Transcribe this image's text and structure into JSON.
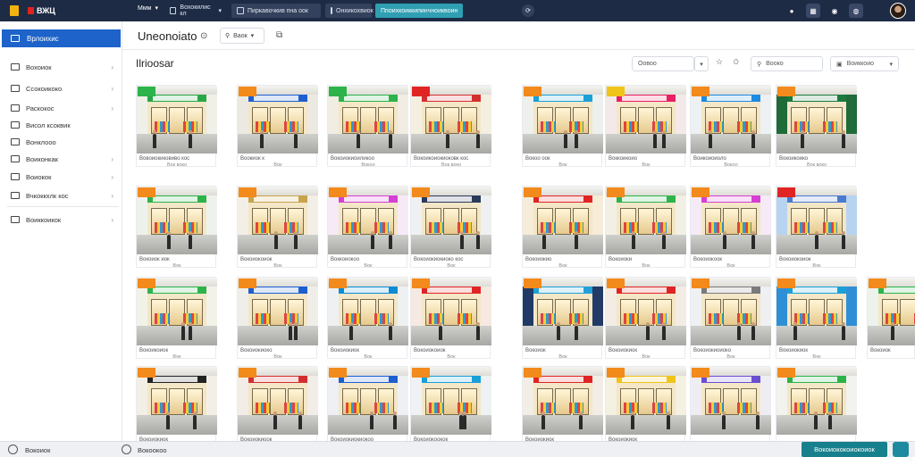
{
  "topbar": {
    "brand": "ВЖЦ",
    "menu1": "Ммм",
    "tab1": "Вохокилис кл",
    "tab2": "Пиркавочкив пна оок",
    "tab3": "Онхикохвиок",
    "search_text": "Ппоихкоиккипинчноиквоиноиикиокк"
  },
  "sidebar": {
    "active": "Врлоихис",
    "items": [
      {
        "label": "Вохоиок"
      },
      {
        "label": "Ссокоикоко"
      },
      {
        "label": "Раскокос"
      },
      {
        "label": "Висол ксоквик"
      },
      {
        "label": "Вонклооо"
      },
      {
        "label": "Воиконкак"
      },
      {
        "label": "Воиокок"
      },
      {
        "label": "Вчкоккхлк кос"
      },
      {
        "label": "Воиккоикок"
      }
    ]
  },
  "header": {
    "title": "Uneonoiato",
    "select": "Ваок"
  },
  "section": {
    "title": "Ilrioosar"
  },
  "controls": {
    "sort": "Оовоо",
    "search": "Вооко",
    "filter": "Воиккоио"
  },
  "cards": [
    {
      "cap": "Вовоиокиковиво кос",
      "sub": "Вок воко",
      "badge": "#2cb34a",
      "sign": "#28a745",
      "accent": "#f0f0e8"
    },
    {
      "cap": "Воокиок к",
      "sub": "Вок",
      "badge": "#f28a1c",
      "sign": "#1d5fd1",
      "accent": "#ece9e2"
    },
    {
      "cap": "Вокоиокиоиликоо",
      "sub": "Вокоо",
      "badge": "#2cb34a",
      "sign": "#2cb34a",
      "accent": "#f1ede3"
    },
    {
      "cap": "Вокоикоиокиоковк кос",
      "sub": "Вок воко",
      "badge": "#e02424",
      "sign": "#d32f2f",
      "accent": "#f5efe2"
    },
    {
      "cap": "Вокоо оок",
      "sub": "Вок",
      "badge": "#f28a1c",
      "sign": "#19a0d8",
      "accent": "#eef0ee"
    },
    {
      "cap": "Воккоикоио",
      "sub": "Вок",
      "badge": "#f0c419",
      "sign": "#e91e63",
      "accent": "#f3e9e9"
    },
    {
      "cap": "Воикоиоиоло",
      "sub": "Вокоо",
      "badge": "#f28a1c",
      "sign": "#1d8be0",
      "accent": "#edf1f4"
    },
    {
      "cap": "Вокоикоико",
      "sub": "Вок воко",
      "badge": "#f28a1c",
      "sign": "#1a7a3c",
      "accent": "#1f6b3a"
    },
    {
      "cap": "Вокоиок иок",
      "sub": "Вок",
      "badge": "#f28a1c",
      "sign": "#2cb34a",
      "accent": "#eef2ec"
    },
    {
      "cap": "Вокоиокоиок",
      "sub": "Вок",
      "badge": "#f28a1c",
      "sign": "#c7a34a",
      "accent": "#f4efe6"
    },
    {
      "cap": "Воккоиокоо",
      "sub": "Вок",
      "badge": "#f28a1c",
      "sign": "#d63fd3",
      "accent": "#f6eaf6"
    },
    {
      "cap": "Вокоиокиокиоко кос",
      "sub": "Вок",
      "badge": "#f28a1c",
      "sign": "#2a3a5a",
      "accent": "#eef0f2"
    },
    {
      "cap": "Вокоиокио",
      "sub": "Вок",
      "badge": "#f28a1c",
      "sign": "#e02424",
      "accent": "#f6ecd8"
    },
    {
      "cap": "Вокоиоки",
      "sub": "Вок",
      "badge": "#f28a1c",
      "sign": "#2cb34a",
      "accent": "#f2f0e4"
    },
    {
      "cap": "Вокоиокоок",
      "sub": "Вок",
      "badge": "#f28a1c",
      "sign": "#d63fd3",
      "accent": "#f6eaf6"
    },
    {
      "cap": "Вокоиокоиок",
      "sub": "Вок",
      "badge": "#e02424",
      "sign": "#4a7bd1",
      "accent": "#b7d3f0"
    },
    {
      "cap": "Вокоикоиок",
      "sub": "Вок",
      "badge": "#f28a1c",
      "sign": "#2cb34a",
      "accent": "#f2f2e8"
    },
    {
      "cap": "Вокоиокиоко",
      "sub": "Вок",
      "badge": "#f28a1c",
      "sign": "#1d5fd1",
      "accent": "#efeee8"
    },
    {
      "cap": "Вокоиокиок",
      "sub": "Вок",
      "badge": "#f28a1c",
      "sign": "#0a8bd6",
      "accent": "#eef0f2"
    },
    {
      "cap": "Вокоиокоиок",
      "sub": "Вок",
      "badge": "#f28a1c",
      "sign": "#e02424",
      "accent": "#f6e9e2"
    },
    {
      "cap": "Вокоиок",
      "sub": "Вок",
      "badge": "#f28a1c",
      "sign": "#22a0d8",
      "accent": "#223a66"
    },
    {
      "cap": "Вокоиокиок",
      "sub": "Вок",
      "badge": "#f28a1c",
      "sign": "#e02424",
      "accent": "#f2ece4"
    },
    {
      "cap": "Вокоиокиоиоко",
      "sub": "Вок",
      "badge": "#f28a1c",
      "sign": "#7a7a7a",
      "accent": "#eef0f2"
    },
    {
      "cap": "Вокоиокиок",
      "sub": "Вок",
      "badge": "#f28a1c",
      "sign": "#19a0d8",
      "accent": "#2f8fd6"
    },
    {
      "cap": "Вокоиок",
      "sub": "",
      "badge": "#f28a1c",
      "sign": "#2cb34a",
      "accent": "#eef2ec"
    },
    {
      "cap": "Вокоиокиок",
      "sub": "",
      "badge": "#f28a1c",
      "sign": "#222222",
      "accent": "#f4efe6"
    },
    {
      "cap": "Вокоиокиоок",
      "sub": "",
      "badge": "#f28a1c",
      "sign": "#d32f2f",
      "accent": "#f2ede6"
    },
    {
      "cap": "Вокоиокиокиокоо",
      "sub": "",
      "badge": "#f28a1c",
      "sign": "#1d5fd1",
      "accent": "#eef0f4"
    },
    {
      "cap": "Вокоиокоокок",
      "sub": "",
      "badge": "#f28a1c",
      "sign": "#19a0d8",
      "accent": "#eef2f4"
    },
    {
      "cap": "Вокоиокиок",
      "sub": "",
      "badge": "#f28a1c",
      "sign": "#e02424",
      "accent": "#f2eee6"
    },
    {
      "cap": "Вокоиокиок",
      "sub": "",
      "badge": "#f28a1c",
      "sign": "#f0c419",
      "accent": "#f4f0e2"
    },
    {
      "cap": "",
      "sub": "",
      "badge": "#f28a1c",
      "sign": "#6a4fd1",
      "accent": "#efedf4"
    },
    {
      "cap": "",
      "sub": "",
      "badge": "#f28a1c",
      "sign": "#2cb34a",
      "accent": "#f2f2ee"
    }
  ],
  "footer": {
    "left": "Вокоиок",
    "mid": "Вокоокоо",
    "button": "Вокоиококоиокоиок"
  }
}
